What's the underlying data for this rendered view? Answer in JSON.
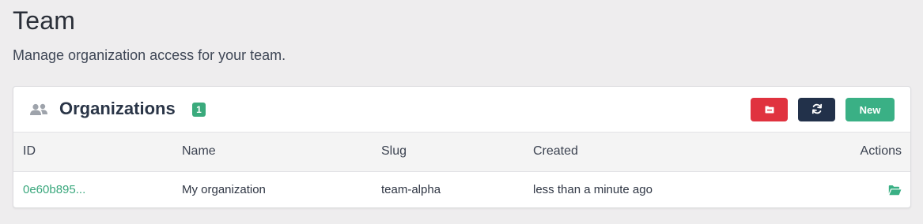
{
  "page": {
    "title": "Team",
    "subtitle": "Manage organization access for your team."
  },
  "card": {
    "icon": "people-icon",
    "title": "Organizations",
    "count": "1",
    "buttons": {
      "archive_icon": "folder-icon",
      "refresh_icon": "refresh-icon",
      "new_label": "New"
    }
  },
  "table": {
    "columns": [
      "ID",
      "Name",
      "Slug",
      "Created",
      "Actions"
    ],
    "rows": [
      {
        "id": "0e60b895...",
        "name": "My organization",
        "slug": "team-alpha",
        "created": "less than a minute ago",
        "action_icon": "folder-open-icon"
      }
    ]
  },
  "colors": {
    "background": "#eeedee",
    "accent_green": "#3ab085",
    "danger_red": "#e0323f",
    "dark_navy": "#22314a"
  }
}
